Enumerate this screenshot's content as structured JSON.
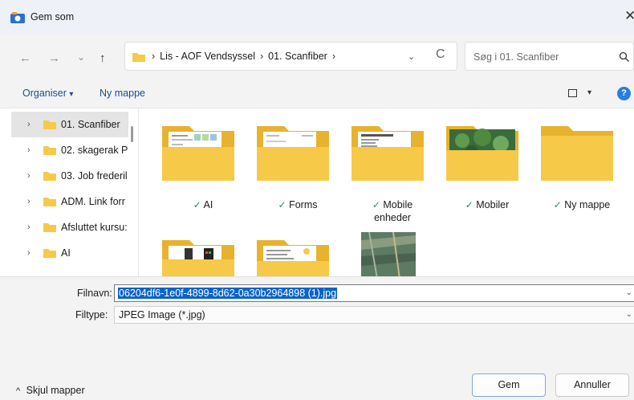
{
  "window": {
    "title": "Gem som",
    "close_glyph": "✕"
  },
  "nav": {
    "back": "←",
    "forward": "→",
    "recent": "⌄",
    "up": "↑",
    "breadcrumb": [
      "Lis - AOF Vendsyssel",
      "01. Scanfiber"
    ],
    "breadcrumb_sep": "›",
    "dropdown": "⌄",
    "refresh": "C"
  },
  "search": {
    "placeholder": "Søg i 01. Scanfiber"
  },
  "toolbar": {
    "organise": "Organiser",
    "organise_arrow": "▾",
    "new_folder": "Ny mappe",
    "view_arrow": "▾",
    "help": "?"
  },
  "sidebar": {
    "items": [
      {
        "label": "01. Scanfiber"
      },
      {
        "label": "02. skagerak P"
      },
      {
        "label": "03. Job frederil"
      },
      {
        "label": "ADM. Link forr"
      },
      {
        "label": "Afsluttet kursu:"
      },
      {
        "label": "AI"
      }
    ],
    "chevron": "›"
  },
  "files": [
    {
      "label": "AI",
      "status": "✓"
    },
    {
      "label": "Forms",
      "status": "✓"
    },
    {
      "label": "Mobile",
      "label2": "enheder",
      "status": "✓"
    },
    {
      "label": "Mobiler",
      "status": "✓"
    },
    {
      "label": "Ny mappe",
      "status": "✓"
    }
  ],
  "form": {
    "filename_label": "Filnavn:",
    "filename_value": "06204df6-1e0f-4899-8d62-0a30b2964898 (1).jpg",
    "filetype_label": "Filtype:",
    "filetype_value": "JPEG Image (*.jpg)",
    "dd": "⌄"
  },
  "footer": {
    "hide_folders": "Skjul mapper",
    "hide_arrow": "^",
    "save": "Gem",
    "cancel": "Annuller"
  },
  "colors": {
    "folder": "#f7c948",
    "folder_dark": "#e7b22e",
    "accent": "#0a64c8"
  }
}
